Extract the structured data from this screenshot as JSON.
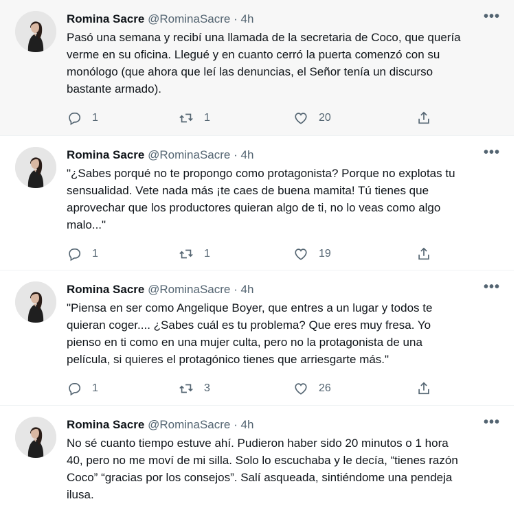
{
  "author": {
    "name": "Romina Sacre",
    "handle": "@RominaSacre",
    "separator": "·",
    "more_label": "•••"
  },
  "tweets": [
    {
      "time": "4h",
      "text": "Pasó una semana y recibí una llamada de la secretaria de Coco, que quería\nverme en su oficina. Llegué y en cuanto cerró la puerta comenzó con su\nmonólogo (que ahora que leí las denuncias, el Señor tenía un discurso\nbastante armado).",
      "replies": "1",
      "retweets": "1",
      "likes": "20"
    },
    {
      "time": "4h",
      "text": "\"¿Sabes porqué no te propongo como protagonista? Porque no explotas tu\nsensualidad. Vete nada más ¡te caes de buena mamita! Tú tienes que\naprovechar que los productores quieran algo de ti, no lo veas como algo\nmalo...\"",
      "replies": "1",
      "retweets": "1",
      "likes": "19"
    },
    {
      "time": "4h",
      "text": "\"Piensa en ser como Angelique Boyer, que entres a un lugar y todos te\nquieran coger.... ¿Sabes cuál es tu problema? Que eres muy fresa. Yo\npienso en ti como en una mujer culta, pero no la protagonista de una\npelícula, si quieres el protagónico tienes que arriesgarte más.\"",
      "replies": "1",
      "retweets": "3",
      "likes": "26"
    },
    {
      "time": "4h",
      "text": "No sé cuanto tiempo estuve ahí. Pudieron haber sido 20 minutos o 1 hora\n40, pero no me moví de mi silla. Solo lo escuchaba y le decía,  “tienes razón\nCoco” “gracias por los consejos”. Salí asqueada, sintiéndome una pendeja\nilusa."
    }
  ],
  "icons": {
    "reply": "reply-icon",
    "retweet": "retweet-icon",
    "like": "heart-icon",
    "share": "share-icon",
    "more": "more-icon"
  },
  "colors": {
    "secondary_text": "#536471",
    "highlight_bg": "#f7f7f7",
    "divider": "#eff3f4"
  }
}
